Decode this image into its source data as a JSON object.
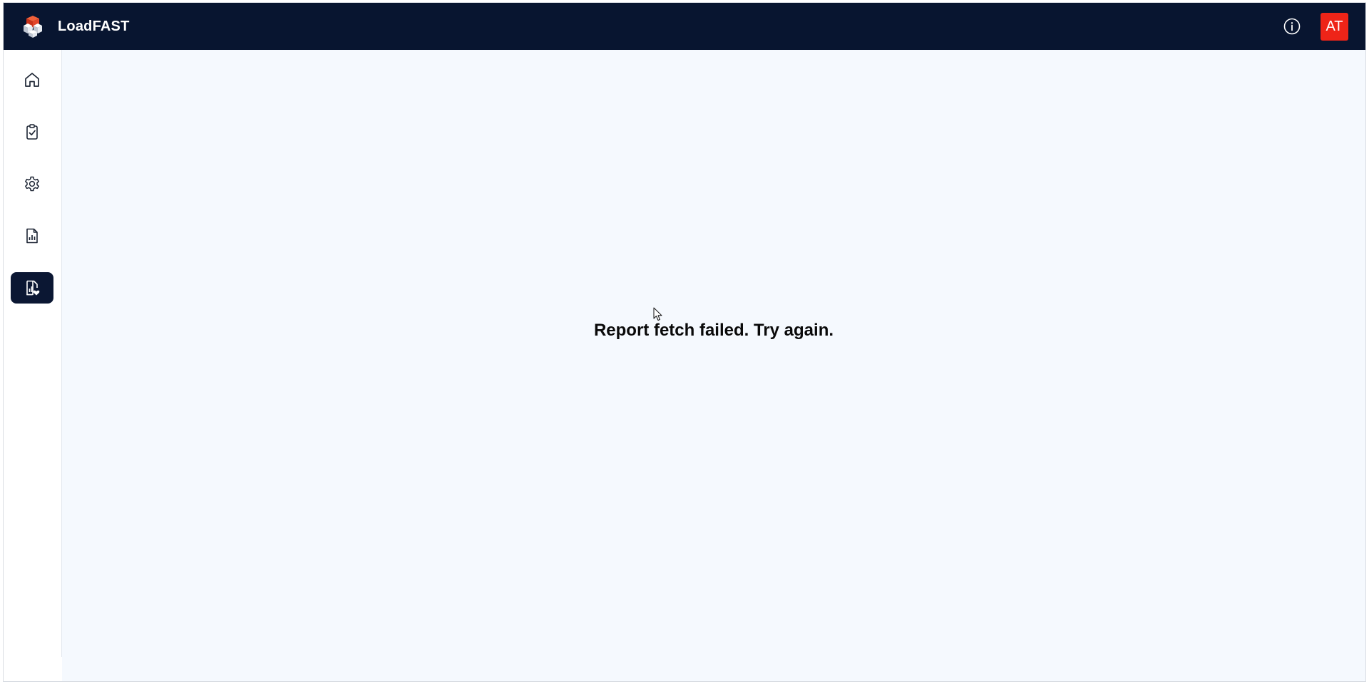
{
  "header": {
    "app_title": "LoadFAST",
    "logo_icon": "boxes-stack-icon",
    "info_icon": "info-circle-icon",
    "avatar_initials": "AT",
    "background_color": "#081530",
    "avatar_color": "#ee2418"
  },
  "sidebar": {
    "items": [
      {
        "icon": "home-icon",
        "active": false
      },
      {
        "icon": "clipboard-check-icon",
        "active": false
      },
      {
        "icon": "gear-icon",
        "active": false
      },
      {
        "icon": "report-chart-icon",
        "active": false
      },
      {
        "icon": "report-heart-icon",
        "active": true
      }
    ],
    "active_color": "#0b1733"
  },
  "main": {
    "message": "Report fetch failed. Try again."
  }
}
